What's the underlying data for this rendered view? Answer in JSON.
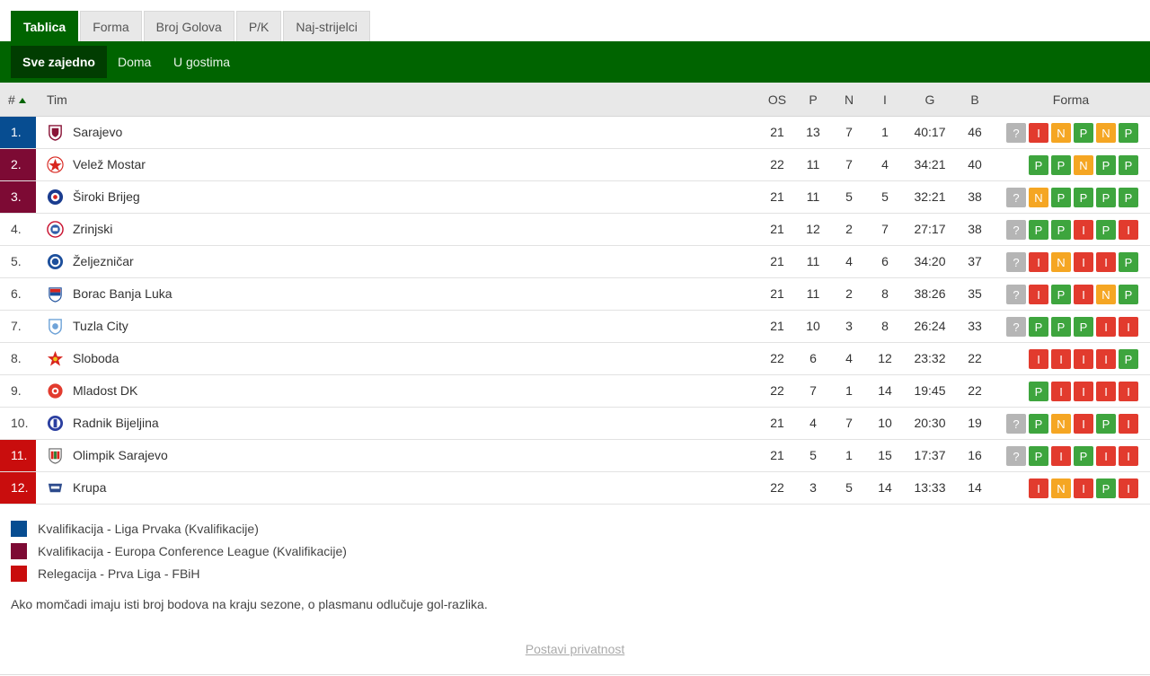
{
  "tabs": [
    "Tablica",
    "Forma",
    "Broj Golova",
    "P/K",
    "Naj-strijelci"
  ],
  "subtabs": [
    "Sve zajedno",
    "Doma",
    "U gostima"
  ],
  "header": {
    "rank": "#",
    "team": "Tim",
    "os": "OS",
    "p": "P",
    "n": "N",
    "i": "I",
    "g": "G",
    "b": "B",
    "forma": "Forma"
  },
  "colors": {
    "green": "#006400",
    "cl": "#074d91",
    "ecl": "#7d0a34",
    "rel": "#c90d0d",
    "win": "#3ea53e",
    "draw": "#f5a623",
    "loss": "#e23b2e",
    "unknown": "#b5b5b5"
  },
  "rows": [
    {
      "rank": "1.",
      "team": "Sarajevo",
      "os": "21",
      "p": "13",
      "n": "7",
      "i": "1",
      "g": "40:17",
      "b": "46",
      "form": [
        "?",
        "I",
        "N",
        "P",
        "N",
        "P"
      ]
    },
    {
      "rank": "2.",
      "team": "Velež Mostar",
      "os": "22",
      "p": "11",
      "n": "7",
      "i": "4",
      "g": "34:21",
      "b": "40",
      "form": [
        "P",
        "P",
        "N",
        "P",
        "P"
      ]
    },
    {
      "rank": "3.",
      "team": "Široki Brijeg",
      "os": "21",
      "p": "11",
      "n": "5",
      "i": "5",
      "g": "32:21",
      "b": "38",
      "form": [
        "?",
        "N",
        "P",
        "P",
        "P",
        "P"
      ]
    },
    {
      "rank": "4.",
      "team": "Zrinjski",
      "os": "21",
      "p": "12",
      "n": "2",
      "i": "7",
      "g": "27:17",
      "b": "38",
      "form": [
        "?",
        "P",
        "P",
        "I",
        "P",
        "I"
      ]
    },
    {
      "rank": "5.",
      "team": "Željezničar",
      "os": "21",
      "p": "11",
      "n": "4",
      "i": "6",
      "g": "34:20",
      "b": "37",
      "form": [
        "?",
        "I",
        "N",
        "I",
        "I",
        "P"
      ]
    },
    {
      "rank": "6.",
      "team": "Borac Banja Luka",
      "os": "21",
      "p": "11",
      "n": "2",
      "i": "8",
      "g": "38:26",
      "b": "35",
      "form": [
        "?",
        "I",
        "P",
        "I",
        "N",
        "P"
      ]
    },
    {
      "rank": "7.",
      "team": "Tuzla City",
      "os": "21",
      "p": "10",
      "n": "3",
      "i": "8",
      "g": "26:24",
      "b": "33",
      "form": [
        "?",
        "P",
        "P",
        "P",
        "I",
        "I"
      ]
    },
    {
      "rank": "8.",
      "team": "Sloboda",
      "os": "22",
      "p": "6",
      "n": "4",
      "i": "12",
      "g": "23:32",
      "b": "22",
      "form": [
        "I",
        "I",
        "I",
        "I",
        "P"
      ]
    },
    {
      "rank": "9.",
      "team": "Mladost DK",
      "os": "22",
      "p": "7",
      "n": "1",
      "i": "14",
      "g": "19:45",
      "b": "22",
      "form": [
        "P",
        "I",
        "I",
        "I",
        "I"
      ]
    },
    {
      "rank": "10.",
      "team": "Radnik Bijeljina",
      "os": "21",
      "p": "4",
      "n": "7",
      "i": "10",
      "g": "20:30",
      "b": "19",
      "form": [
        "?",
        "P",
        "N",
        "I",
        "P",
        "I"
      ]
    },
    {
      "rank": "11.",
      "team": "Olimpik Sarajevo",
      "os": "21",
      "p": "5",
      "n": "1",
      "i": "15",
      "g": "17:37",
      "b": "16",
      "form": [
        "?",
        "P",
        "I",
        "P",
        "I",
        "I"
      ]
    },
    {
      "rank": "12.",
      "team": "Krupa",
      "os": "22",
      "p": "3",
      "n": "5",
      "i": "14",
      "g": "13:33",
      "b": "14",
      "form": [
        "I",
        "N",
        "I",
        "P",
        "I"
      ]
    }
  ],
  "legend": [
    {
      "label": "Kvalifikacija - Liga Prvaka (Kvalifikacije)",
      "color": "#074d91"
    },
    {
      "label": "Kvalifikacija - Europa Conference League (Kvalifikacije)",
      "color": "#7d0a34"
    },
    {
      "label": "Relegacija - Prva Liga - FBiH",
      "color": "#c90d0d"
    }
  ],
  "note": "Ako momčadi imaju isti broj bodova na kraju sezone, o plasmanu odlučuje gol-razlika.",
  "privacy": "Postavi privatnost"
}
